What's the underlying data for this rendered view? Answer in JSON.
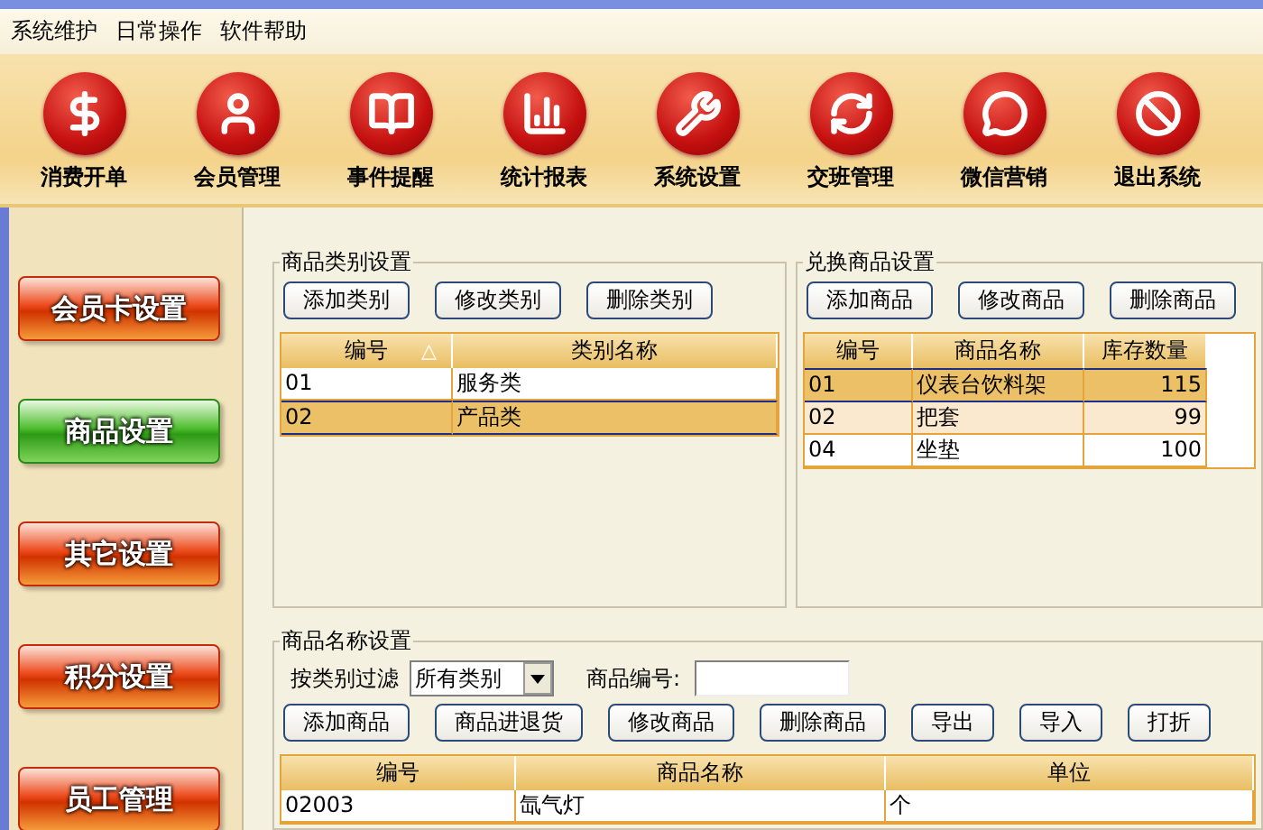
{
  "menu": [
    "系统维护",
    "日常操作",
    "软件帮助"
  ],
  "toolbar": [
    {
      "label": "消费开单",
      "kind": "dollar"
    },
    {
      "label": "会员管理",
      "kind": "person"
    },
    {
      "label": "事件提醒",
      "kind": "book"
    },
    {
      "label": "统计报表",
      "kind": "chart"
    },
    {
      "label": "系统设置",
      "kind": "tools"
    },
    {
      "label": "交班管理",
      "kind": "refresh"
    },
    {
      "label": "微信营销",
      "kind": "chat"
    },
    {
      "label": "退出系统",
      "kind": "ban"
    }
  ],
  "sidebar": [
    {
      "label": "会员卡设置",
      "selected": false
    },
    {
      "label": "商品设置",
      "selected": true
    },
    {
      "label": "其它设置",
      "selected": false
    },
    {
      "label": "积分设置",
      "selected": false
    },
    {
      "label": "员工管理",
      "selected": false
    }
  ],
  "category_panel": {
    "title": "商品类别设置",
    "buttons": [
      "添加类别",
      "修改类别",
      "删除类别"
    ],
    "table": {
      "columns": [
        {
          "label": "编号",
          "sort": "△"
        },
        {
          "label": "类别名称"
        }
      ],
      "rows": [
        {
          "cells": [
            "01",
            "服务类"
          ],
          "selected": false
        },
        {
          "cells": [
            "02",
            "产品类"
          ],
          "selected": true
        }
      ]
    }
  },
  "exchange_panel": {
    "title": "兑换商品设置",
    "buttons": [
      "添加商品",
      "修改商品",
      "删除商品"
    ],
    "table": {
      "columns": [
        {
          "label": "编号"
        },
        {
          "label": "商品名称"
        },
        {
          "label": "库存数量",
          "kind": "number"
        }
      ],
      "rows": [
        {
          "cells": [
            "01",
            "仪表台饮料架",
            "115"
          ],
          "selected": true
        },
        {
          "cells": [
            "02",
            "把套",
            "99"
          ],
          "selected": false
        },
        {
          "cells": [
            "04",
            "坐垫",
            "100"
          ],
          "selected": false
        }
      ]
    }
  },
  "goods_panel": {
    "title": "商品名称设置",
    "filter_label": "按类别过滤",
    "filter_value": "所有类别",
    "code_label": "商品编号:",
    "buttons": [
      "添加商品",
      "商品进退货",
      "修改商品",
      "删除商品",
      "导出",
      "导入",
      "打折"
    ],
    "table": {
      "columns": [
        {
          "label": "编号"
        },
        {
          "label": "商品名称"
        },
        {
          "label": "单位"
        }
      ],
      "rows": [
        {
          "cells": [
            "02003",
            "氙气灯",
            "个"
          ],
          "selected": false
        }
      ]
    }
  }
}
